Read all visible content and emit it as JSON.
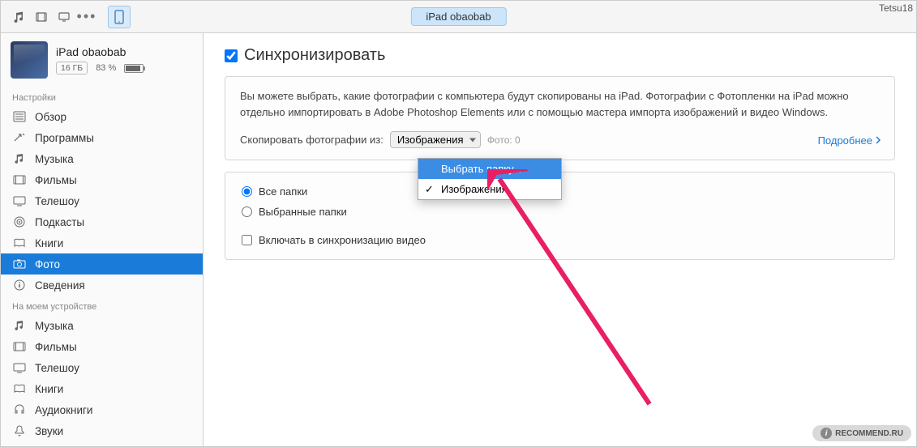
{
  "toolbar": {
    "device_pill": "iPad obaobab"
  },
  "watermark": "Tetsu18",
  "device": {
    "name": "iPad obaobab",
    "capacity": "16 ГБ",
    "battery_pct": "83 %"
  },
  "sidebar": {
    "section1": "Настройки",
    "section2": "На моем устройстве",
    "settings": [
      {
        "label": "Обзор"
      },
      {
        "label": "Программы"
      },
      {
        "label": "Музыка"
      },
      {
        "label": "Фильмы"
      },
      {
        "label": "Телешоу"
      },
      {
        "label": "Подкасты"
      },
      {
        "label": "Книги"
      },
      {
        "label": "Фото"
      },
      {
        "label": "Сведения"
      }
    ],
    "ondevice": [
      {
        "label": "Музыка"
      },
      {
        "label": "Фильмы"
      },
      {
        "label": "Телешоу"
      },
      {
        "label": "Книги"
      },
      {
        "label": "Аудиокниги"
      },
      {
        "label": "Звуки"
      }
    ]
  },
  "content": {
    "sync_label": "Синхронизировать",
    "info_text": "Вы можете выбрать, какие фотографии с компьютера будут скопированы на iPad. Фотографии с Фотопленки на iPad можно отдельно импортировать в Adobe Photoshop Elements или с помощью мастера импорта изображений и видео Windows.",
    "copy_from_label": "Скопировать фотографии из:",
    "select_value": "Изображения",
    "photo_count": "Фото: 0",
    "more_link": "Подробнее",
    "radio1": "Все папки",
    "radio2": "Выбранные папки",
    "check1": "Включать в синхронизацию видео"
  },
  "dropdown": {
    "item1": "Выбрать папку...",
    "item2": "Изображения"
  },
  "footer_badge": "RECOMMEND.RU"
}
